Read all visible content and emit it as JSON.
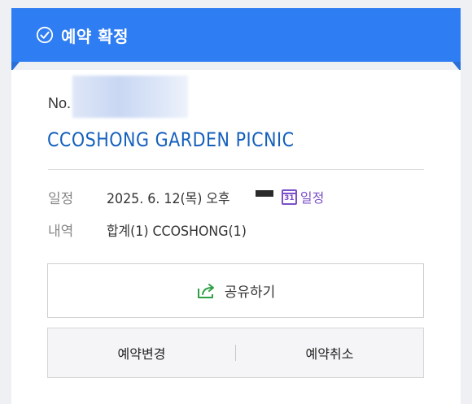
{
  "banner": {
    "title": "예약 확정",
    "icon": "check-circle-icon",
    "color": "#2f7df2"
  },
  "reservation": {
    "order_label": "No.",
    "title": "CCOSHONG GARDEN PICNIC",
    "schedule_key": "일정",
    "schedule_value": "2025. 6. 12(목) 오후",
    "calendar_link": "일정",
    "calendar_icon_day": "31",
    "detail_key": "내역",
    "detail_value": "합계(1) CCOSHONG(1)"
  },
  "actions": {
    "share_label": "공유하기",
    "change_label": "예약변경",
    "cancel_label": "예약취소"
  },
  "colors": {
    "title": "#1560bd",
    "calendar": "#7b4fc7",
    "share_icon": "#2e9e44"
  }
}
